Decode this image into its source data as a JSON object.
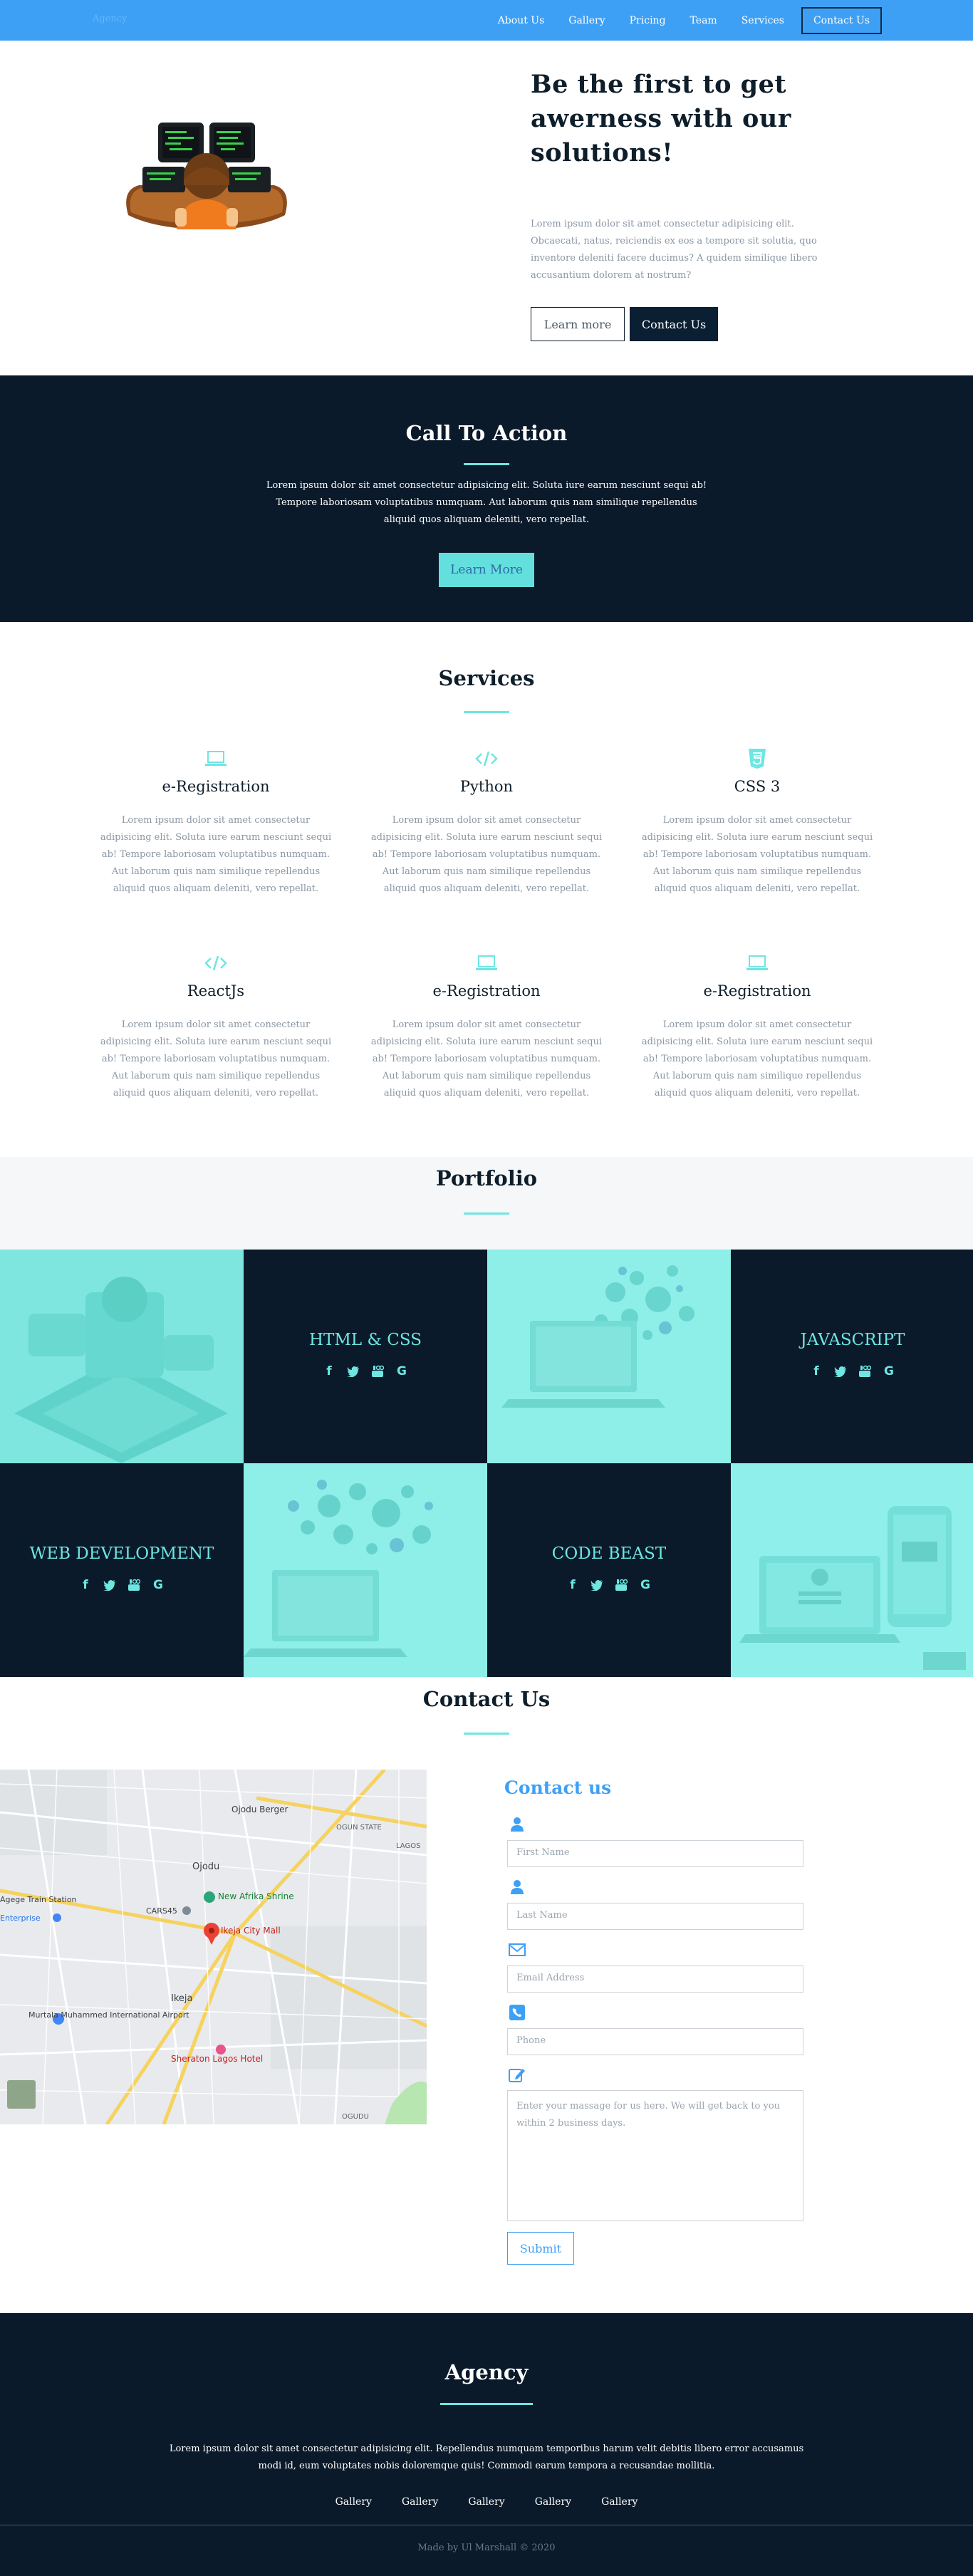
{
  "nav": {
    "brand": "Agency",
    "links": [
      "About Us",
      "Gallery",
      "Pricing",
      "Team",
      "Services"
    ],
    "cta": "Contact Us"
  },
  "hero": {
    "title": "Be the first to get awerness with our solutions!",
    "text": "Lorem ipsum dolor sit amet consectetur adipisicing elit. Obcaecati, natus, reiciendis ex eos a tempore sit solutia, quo inventore deleniti facere ducimus? A quidem similique libero accusantium dolorem at nostrum?",
    "learn_more": "Learn more",
    "contact": "Contact Us"
  },
  "cta": {
    "title": "Call To Action",
    "text": "Lorem ipsum dolor sit amet consectetur adipisicing elit. Soluta iure earum nesciunt sequi ab! Tempore laboriosam voluptatibus numquam. Aut laborum quis nam similique repellendus aliquid quos aliquam deleniti, vero repellat.",
    "button": "Learn More"
  },
  "services": {
    "title": "Services",
    "items": [
      {
        "icon": "laptop-icon",
        "title": "e-Registration",
        "text": "Lorem ipsum dolor sit amet consectetur adipisicing elit. Soluta iure earum nesciunt sequi ab! Tempore laboriosam voluptatibus numquam. Aut laborum quis nam similique repellendus aliquid quos aliquam deleniti, vero repellat."
      },
      {
        "icon": "code-icon",
        "title": "Python",
        "text": "Lorem ipsum dolor sit amet consectetur adipisicing elit. Soluta iure earum nesciunt sequi ab! Tempore laboriosam voluptatibus numquam. Aut laborum quis nam similique repellendus aliquid quos aliquam deleniti, vero repellat."
      },
      {
        "icon": "css3-icon",
        "title": "CSS 3",
        "text": "Lorem ipsum dolor sit amet consectetur adipisicing elit. Soluta iure earum nesciunt sequi ab! Tempore laboriosam voluptatibus numquam. Aut laborum quis nam similique repellendus aliquid quos aliquam deleniti, vero repellat."
      },
      {
        "icon": "code-icon",
        "title": "ReactJs",
        "text": "Lorem ipsum dolor sit amet consectetur adipisicing elit. Soluta iure earum nesciunt sequi ab! Tempore laboriosam voluptatibus numquam. Aut laborum quis nam similique repellendus aliquid quos aliquam deleniti, vero repellat."
      },
      {
        "icon": "laptop-icon",
        "title": "e-Registration",
        "text": "Lorem ipsum dolor sit amet consectetur adipisicing elit. Soluta iure earum nesciunt sequi ab! Tempore laboriosam voluptatibus numquam. Aut laborum quis nam similique repellendus aliquid quos aliquam deleniti, vero repellat."
      },
      {
        "icon": "laptop-icon",
        "title": "e-Registration",
        "text": "Lorem ipsum dolor sit amet consectetur adipisicing elit. Soluta iure earum nesciunt sequi ab! Tempore laboriosam voluptatibus numquam. Aut laborum quis nam similique repellendus aliquid quos aliquam deleniti, vero repellat."
      }
    ]
  },
  "portfolio": {
    "title": "Portfolio",
    "labels": [
      "HTML & CSS",
      "JAVASCRIPT",
      "WEB DEVELOPMENT",
      "CODE BEAST"
    ],
    "social_icons": [
      "facebook-icon",
      "twitter-icon",
      "youtube-icon",
      "google-icon"
    ]
  },
  "contact": {
    "title": "Contact Us",
    "form_title": "Contact us",
    "first_name": "First Name",
    "last_name": "Last Name",
    "email": "Email Address",
    "phone": "Phone",
    "message": "Enter your massage for us here. We will get back to you within 2 business days.",
    "submit": "Submit"
  },
  "map": {
    "labels": [
      "Ojodu Berger",
      "Ojodu",
      "Agege Train Station",
      "New Afrika Shrine",
      "CARS45",
      "Ikeja City Mall",
      "Enterprise",
      "Ikeja",
      "Murtala Muhammed International Airport",
      "Sheraton Lagos Hotel",
      "OGUDU",
      "OGUN STATE",
      "LAGOS",
      "Sheraton Lagos",
      "Ikeja City Mall"
    ]
  },
  "footer": {
    "title": "Agency",
    "text": "Lorem ipsum dolor sit amet consectetur adipisicing elit. Repellendus numquam temporibus harum velit debitis libero error accusamus modi id, eum voluptates nobis doloremque quis! Commodi earum tempora a recusandae mollitia.",
    "links": [
      "Gallery",
      "Gallery",
      "Gallery",
      "Gallery",
      "Gallery"
    ],
    "copyright": "Made by Ul Marshall © 2020"
  },
  "colors": {
    "accent": "#3ea0f5",
    "teal": "#6ee6e2",
    "dark": "#0b1a2a"
  }
}
